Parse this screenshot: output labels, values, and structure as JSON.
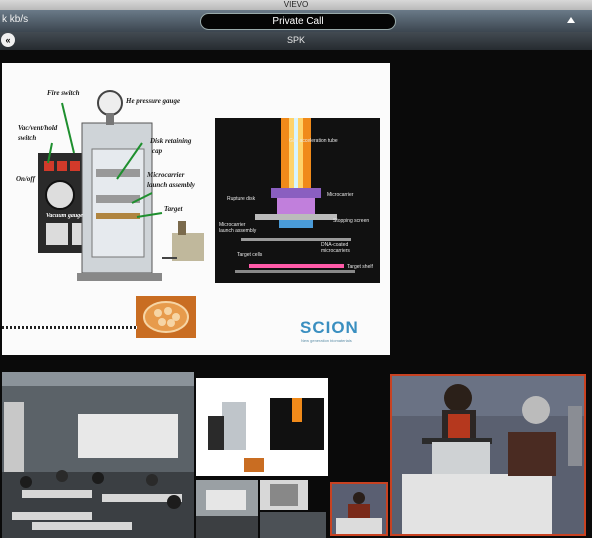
{
  "window": {
    "title": "VIEVO"
  },
  "toolbar": {
    "rate": "k kb/s",
    "call_status": "Private Call"
  },
  "subbar": {
    "label": "SPK",
    "back_icon": "back-icon"
  },
  "slide": {
    "labels": {
      "fire_switch": "Fire switch",
      "he_pressure_gauge": "He pressure gauge",
      "vac_vent_hold": "Vac/vent/hold",
      "switch": "switch",
      "disk_retaining": "Disk retaining",
      "cap": "cap",
      "on_off": "On/off",
      "microcarrier": "Microcarrier",
      "launch_assembly": "launch assembly",
      "target": "Target",
      "vacuum_gauge": "Vacuum gauge"
    },
    "diagram_labels": {
      "gas_tube": "Gas acceleration tube",
      "rupture_disk": "Rupture disk",
      "microcarrier": "Microcarrier",
      "launch_assembly": "Microcarrier launch assembly",
      "stopping_screen": "Stopping screen",
      "dna_coated": "DNA-coated microcarriers",
      "target_cells": "Target cells",
      "target_shelf": "Target shelf"
    },
    "logo_text": "SCION",
    "logo_sub": "New generation biomaterials"
  },
  "colors": {
    "accent_frame": "#c84222",
    "logo": "#3a8fc0"
  }
}
